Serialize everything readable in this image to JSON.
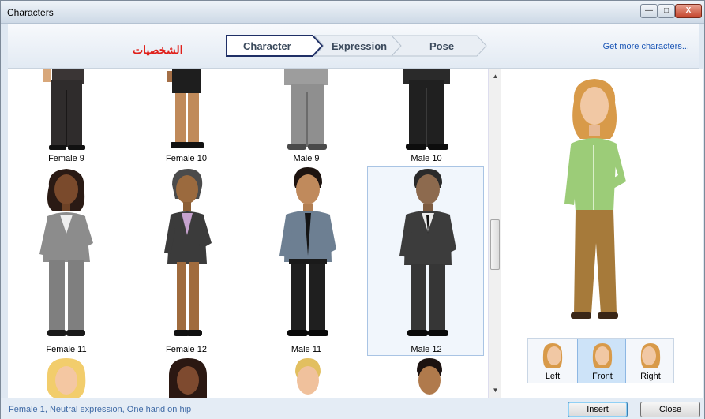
{
  "window": {
    "title": "Characters",
    "min_symbol": "—",
    "max_symbol": "□",
    "close_symbol": "X"
  },
  "header": {
    "arabic_label": "الشخصيات",
    "steps": [
      "Character",
      "Expression",
      "Pose"
    ],
    "more_link": "Get more characters..."
  },
  "gallery": {
    "row1": [
      "Female 9",
      "Female 10",
      "Male 9",
      "Male 10"
    ],
    "row2": [
      "Female 11",
      "Female 12",
      "Male 11",
      "Male 12"
    ]
  },
  "preview": {
    "views": [
      "Left",
      "Front",
      "Right"
    ]
  },
  "footer": {
    "status": "Female 1, Neutral expression, One hand on hip",
    "insert_label": "Insert",
    "close_label": "Close"
  },
  "colors": {
    "accent": "#1a55b5",
    "arabic": "#e0201a",
    "selection": "#cde3f8"
  }
}
